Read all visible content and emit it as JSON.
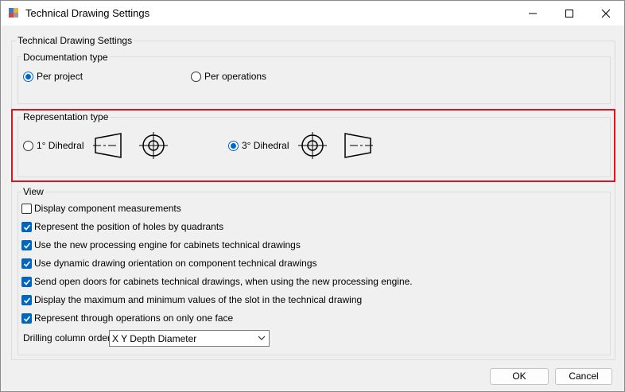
{
  "window": {
    "title": "Technical Drawing Settings"
  },
  "main_group": {
    "label": "Technical Drawing Settings"
  },
  "documentation": {
    "label": "Documentation type",
    "options": [
      {
        "label": "Per project",
        "checked": true
      },
      {
        "label": "Per operations",
        "checked": false
      }
    ]
  },
  "representation": {
    "label": "Representation type",
    "options": [
      {
        "label": "1° Dihedral",
        "checked": false
      },
      {
        "label": "3° Dihedral",
        "checked": true
      }
    ]
  },
  "view": {
    "label": "View",
    "checkboxes": [
      {
        "label": "Display component measurements",
        "checked": false
      },
      {
        "label": "Represent the position of holes by quadrants",
        "checked": true
      },
      {
        "label": "Use the new processing engine for cabinets technical drawings",
        "checked": true
      },
      {
        "label": "Use dynamic drawing orientation on component technical drawings",
        "checked": true
      },
      {
        "label": "Send open doors for cabinets technical drawings, when using the new processing engine.",
        "checked": true
      },
      {
        "label": "Display the maximum and minimum values of the slot in the technical drawing",
        "checked": true
      },
      {
        "label": "Represent through operations on only one face",
        "checked": true
      }
    ],
    "drilling_label": "Drilling column order",
    "drilling_value": "X Y Depth Diameter"
  },
  "buttons": {
    "ok": "OK",
    "cancel": "Cancel"
  },
  "colors": {
    "accent": "#0067c0",
    "highlight": "#e0141e"
  }
}
